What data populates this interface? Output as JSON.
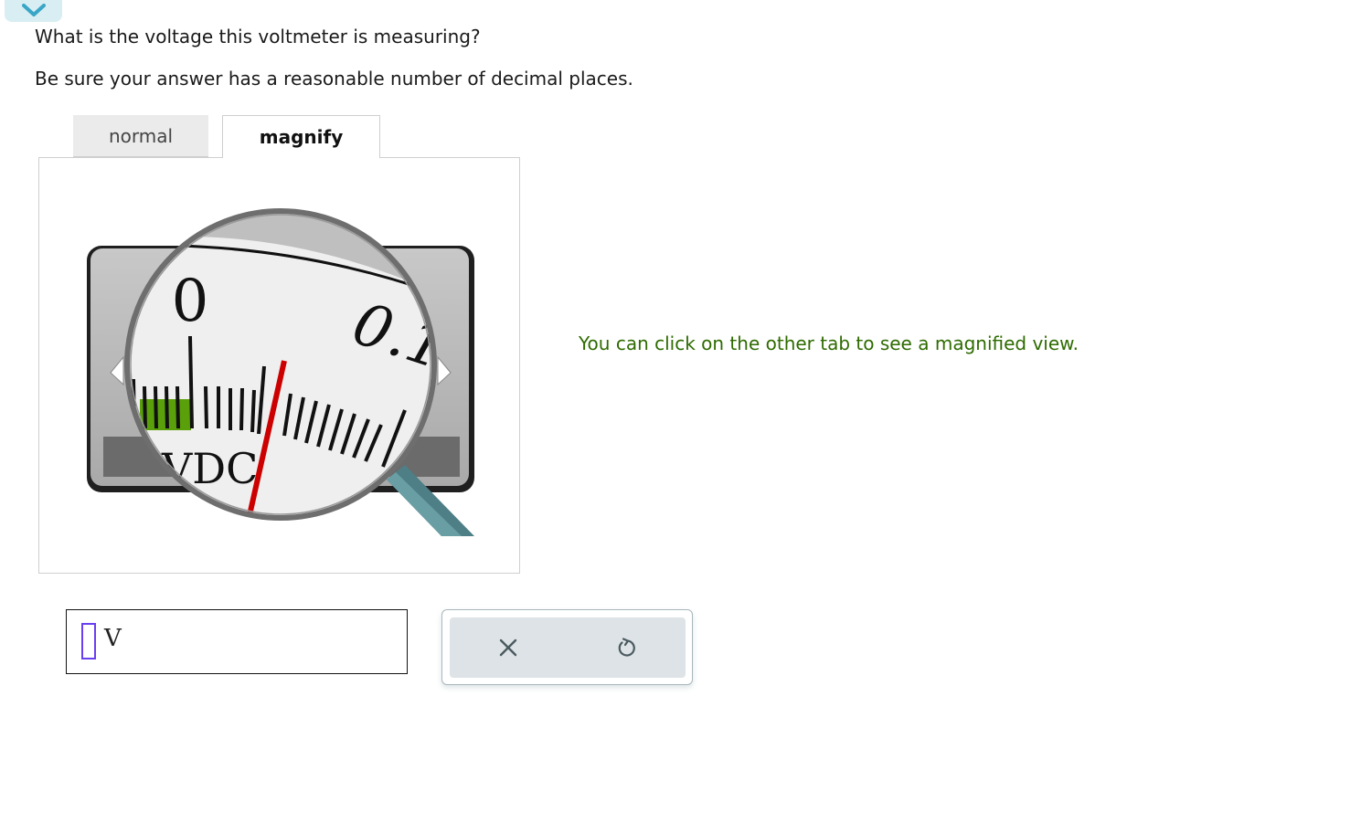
{
  "question": {
    "line1": "What is the voltage this voltmeter is measuring?",
    "line2": "Be sure your answer has a reasonable number of decimal places."
  },
  "tabs": [
    {
      "label": "normal",
      "active": false
    },
    {
      "label": "magnify",
      "active": true
    }
  ],
  "meter": {
    "scale_label_zero": "0",
    "scale_label_next": "0.1",
    "unit_label": "VDC"
  },
  "hint": "You can click on the other tab to see a magnified view.",
  "answer": {
    "value": "",
    "unit": "V"
  },
  "tools": {
    "clear_icon": "x-icon",
    "undo_icon": "undo-icon"
  },
  "colors": {
    "hint_text": "#2e6b00",
    "needle": "#cc0000",
    "green_band": "#5aa00a",
    "cursor": "#6a3ff0",
    "collapse_chevron": "#3aa6c6"
  }
}
